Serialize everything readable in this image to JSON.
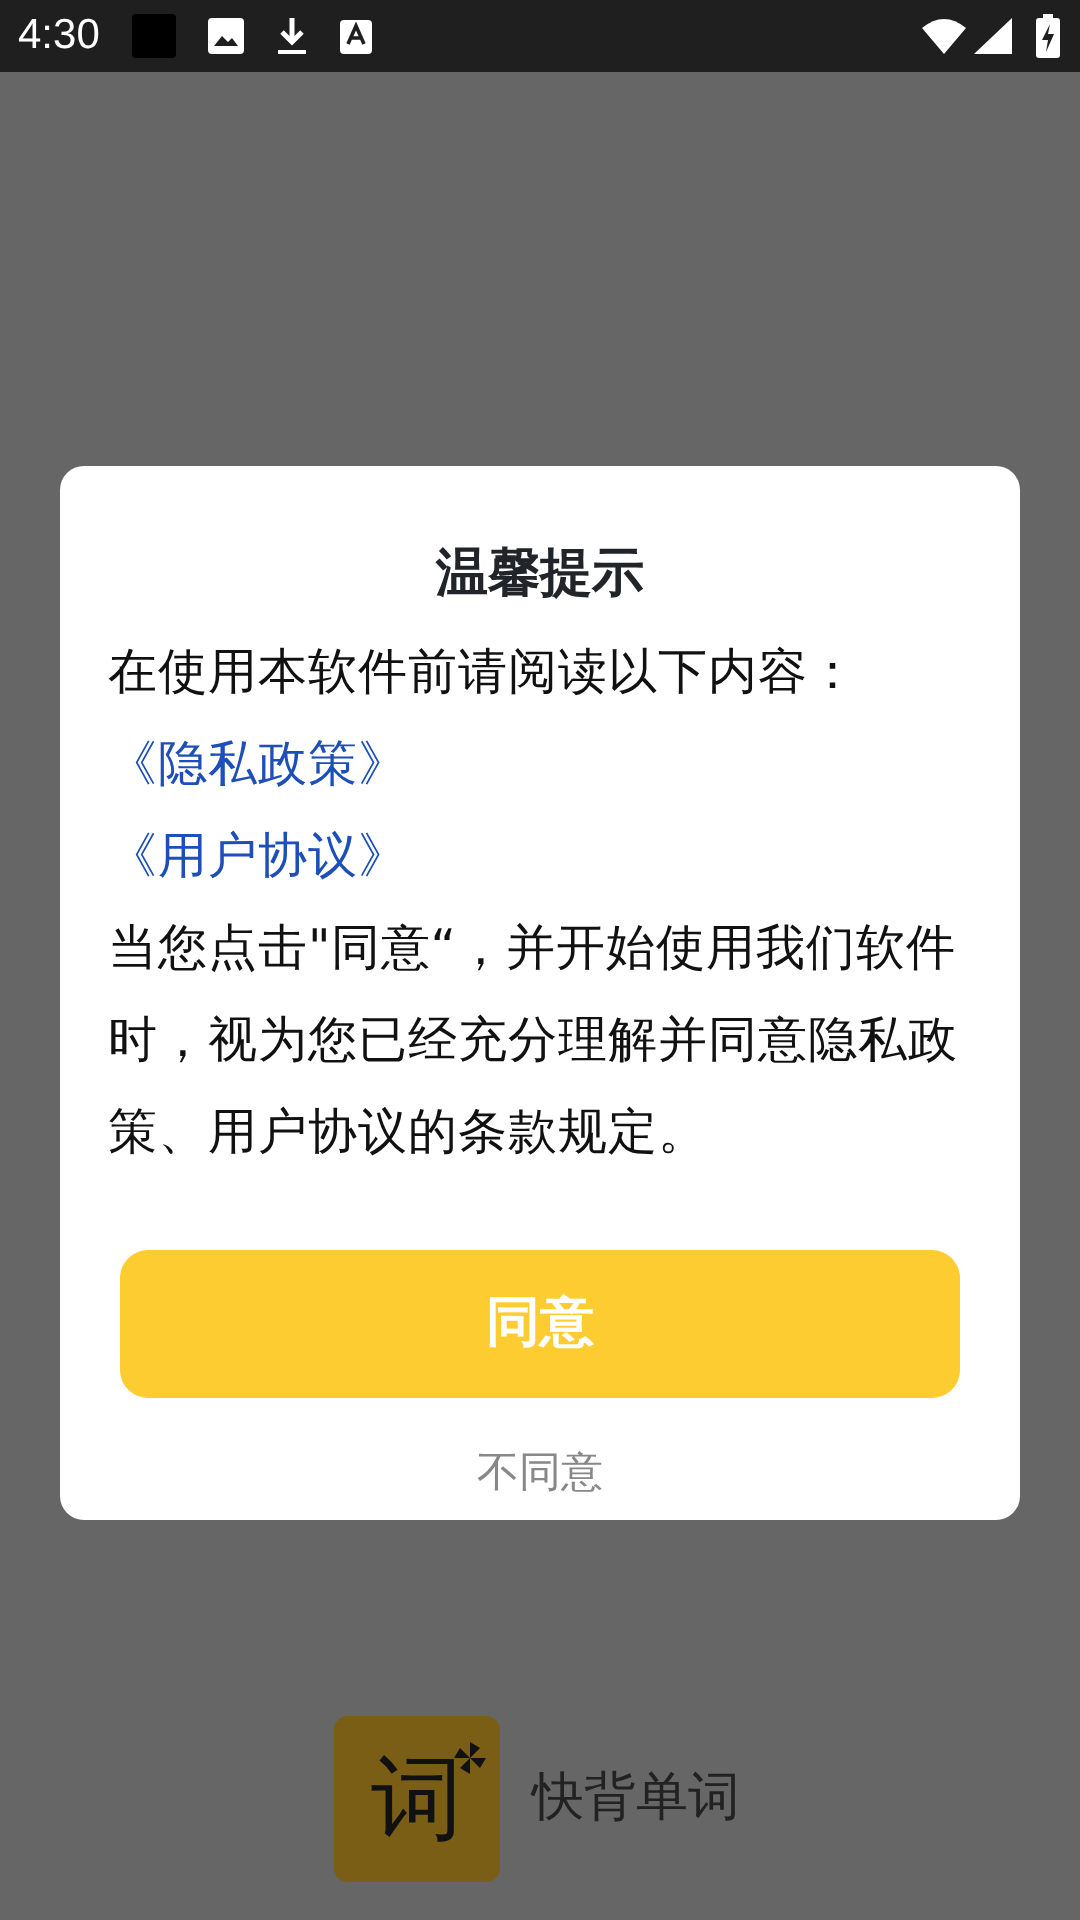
{
  "status_bar": {
    "time": "4:30"
  },
  "dialog": {
    "title": "温馨提示",
    "intro": "在使用本软件前请阅读以下内容：",
    "links": [
      "《隐私政策》",
      "《用户协议》"
    ],
    "body": "当您点击\"同意“，并开始使用我们软件时，视为您已经充分理解并同意隐私政策、用户协议的条款规定。",
    "agree_button": "同意",
    "decline_link": "不同意"
  },
  "app": {
    "name": "快背单词",
    "logo_text": "词"
  }
}
